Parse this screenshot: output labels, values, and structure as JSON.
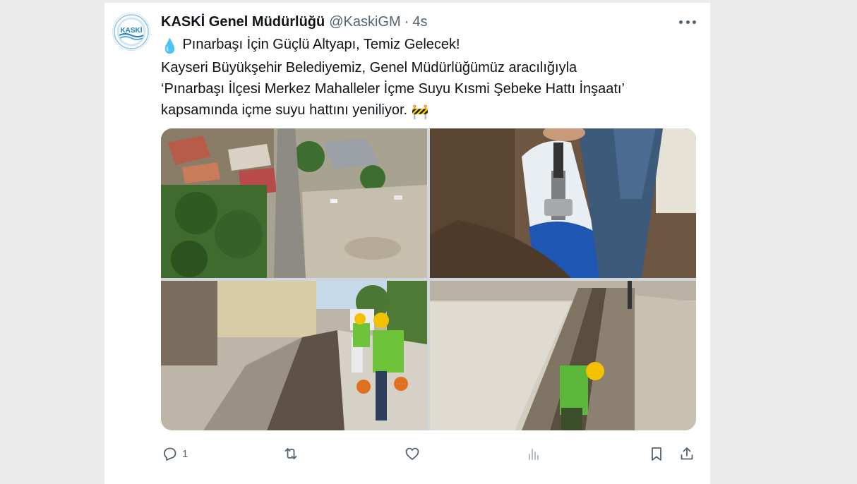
{
  "tweet": {
    "display_name": "KASKİ Genel Müdürlüğü",
    "handle": "@KaskiGM",
    "separator": "·",
    "time": "4s",
    "avatar_logo_text": "KASKİ",
    "text_lines": [
      "Pınarbaşı İçin Güçlü Altyapı, Temiz Gelecek!",
      "Kayseri Büyükşehir Belediyemiz, Genel Müdürlüğümüz aracılığıyla",
      "‘Pınarbaşı İlçesi Merkez Mahalleler İçme Suyu Kısmi Şebeke Hattı İnşaatı’",
      "kapsamında içme suyu hattını yeniliyor."
    ],
    "emoji": {
      "droplet": "💧",
      "construction": "🚧"
    },
    "media_count": 4,
    "reply_count": "1",
    "retweet_count": "",
    "like_count": "",
    "views_count": ""
  },
  "icons": {
    "more": "more-icon",
    "reply": "reply-icon",
    "retweet": "retweet-icon",
    "like": "heart-icon",
    "views": "views-icon",
    "bookmark": "bookmark-icon",
    "share": "share-icon"
  },
  "colors": {
    "text": "#0f1419",
    "secondary": "#536471",
    "card": "#ffffff",
    "background": "#ebebeb",
    "logo_blue": "#1d7fc1"
  }
}
